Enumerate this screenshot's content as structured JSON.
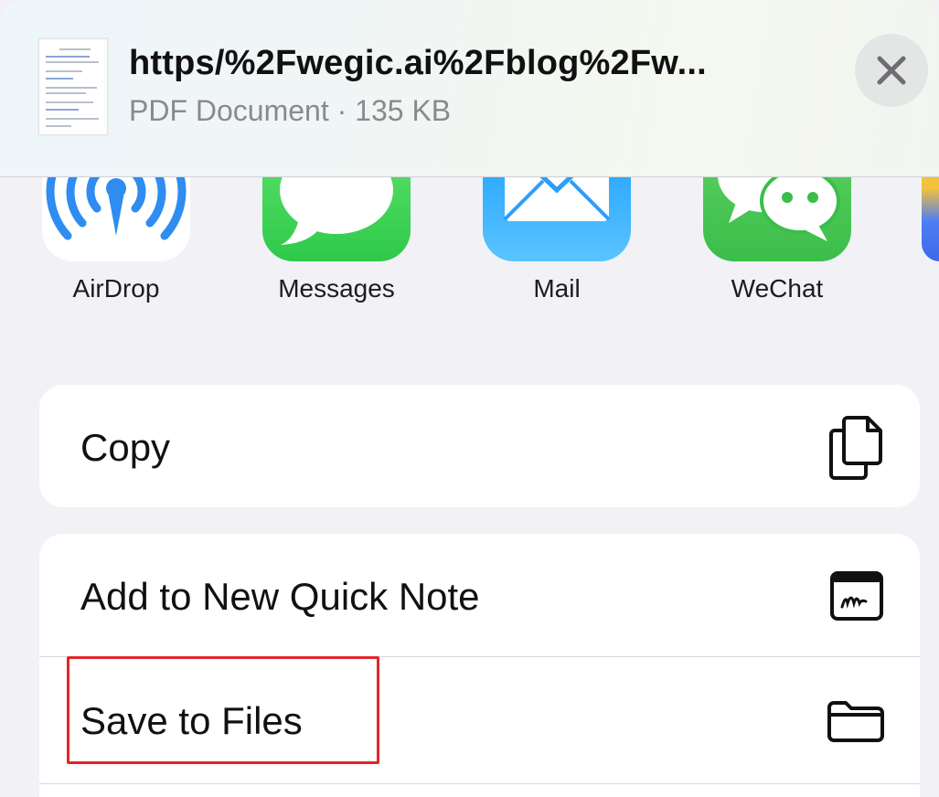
{
  "header": {
    "title": "https/%2Fwegic.ai%2Fblog%2Fw...",
    "subtitle": "PDF Document · 135 KB"
  },
  "apps": [
    {
      "label": "AirDrop",
      "icon": "airdrop-icon"
    },
    {
      "label": "Messages",
      "icon": "messages-icon"
    },
    {
      "label": "Mail",
      "icon": "mail-icon"
    },
    {
      "label": "WeChat",
      "icon": "wechat-icon"
    }
  ],
  "actions": {
    "copy": {
      "label": "Copy",
      "icon": "copy-icon"
    },
    "quick_note": {
      "label": "Add to New Quick Note",
      "icon": "quick-note-icon"
    },
    "save_to_files": {
      "label": "Save to Files",
      "icon": "folder-icon"
    }
  },
  "colors": {
    "highlight": "#e3262a",
    "messages_green": "#2fc94a",
    "mail_blue": "#1a9bff",
    "wechat_green": "#3bbd4a",
    "airdrop_blue": "#2f8cf0"
  }
}
